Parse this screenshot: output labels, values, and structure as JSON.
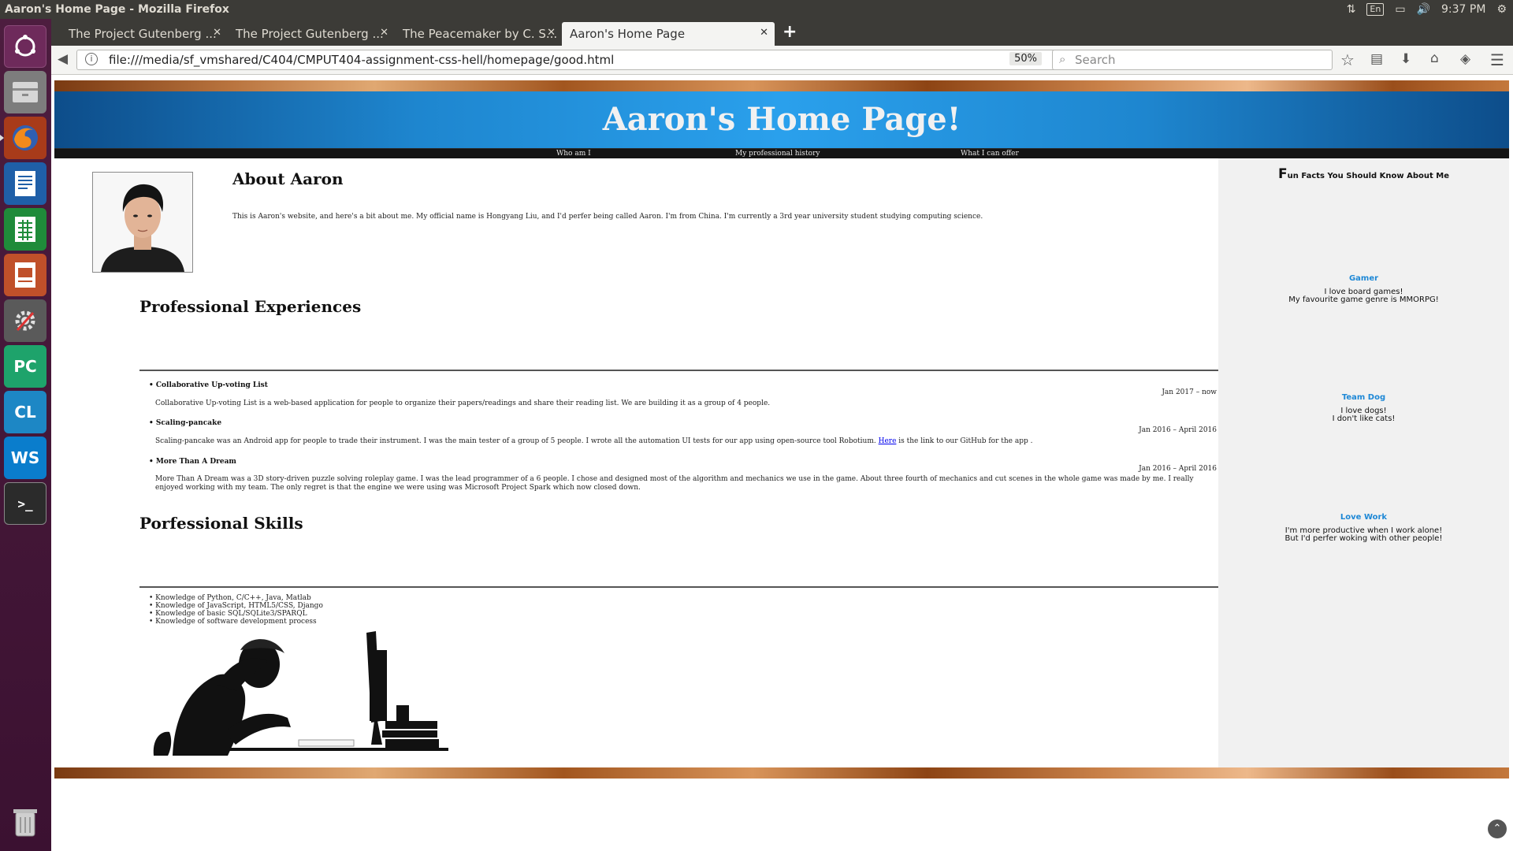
{
  "window": {
    "title": "Aaron's Home Page - Mozilla Firefox",
    "indicators": {
      "keyboard": "En",
      "clock": "9:37 PM"
    }
  },
  "launcher": {
    "items": [
      {
        "name": "ubuntu-dash-icon",
        "label": "",
        "color": "#6e2a5b"
      },
      {
        "name": "files-icon",
        "label": "",
        "color": "#6b6b6b"
      },
      {
        "name": "firefox-icon",
        "label": "",
        "color": "#e66000"
      },
      {
        "name": "writer-icon",
        "label": "",
        "color": "#1f5fa8"
      },
      {
        "name": "calc-icon",
        "label": "",
        "color": "#1f8b3a"
      },
      {
        "name": "impress-icon",
        "label": "",
        "color": "#c0502a"
      },
      {
        "name": "settings-icon",
        "label": "",
        "color": "#5a5a5a"
      },
      {
        "name": "pycharm-icon",
        "label": "PC",
        "color": "#1ea36b"
      },
      {
        "name": "clion-icon",
        "label": "CL",
        "color": "#1d87c5"
      },
      {
        "name": "webstorm-icon",
        "label": "WS",
        "color": "#0a7dcc"
      },
      {
        "name": "terminal-icon",
        "label": ">_",
        "color": "#2b2b2b"
      }
    ],
    "trash": "trash-icon"
  },
  "browser": {
    "tabs": [
      {
        "label": "The Project Gutenberg ...",
        "active": false
      },
      {
        "label": "The Project Gutenberg ...",
        "active": false
      },
      {
        "label": "The Peacemaker by C. S...",
        "active": false
      },
      {
        "label": "Aaron's Home Page",
        "active": true
      }
    ],
    "url": "file:///media/sf_vmshared/C404/CMPUT404-assignment-css-hell/homepage/good.html",
    "zoom": "50%",
    "search_placeholder": "Search"
  },
  "page": {
    "header_title": "Aaron's Home Page!",
    "nav": [
      "Who am I",
      "My professional history",
      "What I can offer"
    ],
    "about": {
      "title": "About Aaron",
      "text": "This is Aaron's website, and here's a bit about me. My official name is Hongyang Liu, and I'd perfer being called Aaron. I'm from China. I'm currently a 3rd year university student studying computing science."
    },
    "experiences": {
      "title": "Professional Experiences",
      "items": [
        {
          "title": "Collaborative Up-voting List",
          "date": "Jan 2017 – now",
          "desc": "Collaborative Up-voting List is a web-based application for people to organize their papers/readings and share their reading list. We are building it as a group of 4 people."
        },
        {
          "title": "Scaling-pancake",
          "date": "Jan 2016 – April 2016",
          "desc_before": "Scaling-pancake was an Android app for people to trade their instrument. I was the main tester of a group of 5 people. I wrote all the automation UI tests for our app using open-source tool Robotium.",
          "link": "Here",
          "desc_after": "is the link to our GitHub for the app ."
        },
        {
          "title": "More Than A Dream",
          "date": "Jan 2016 – April 2016",
          "desc": "More Than A Dream was a 3D story-driven puzzle solving roleplay game. I was the lead programmer of a 6 people. I chose and designed most of the algorithm and mechanics we use in the game. About three fourth of mechanics and cut scenes in the whole game was made by me. I really enjoyed working with my team. The only regret is that the engine we were using was Microsoft Project Spark which now closed down."
        }
      ]
    },
    "skills": {
      "title": "Porfessional Skills",
      "items": [
        "Knowledge of Python, C/C++, Java, Matlab",
        "Knowledge of JavaScript, HTML5/CSS, Django",
        "Knowledge of basic SQL/SQLite3/SPARQL",
        "Knowledge of software development process"
      ]
    },
    "sidebar": {
      "title_initial": "F",
      "title_rest": "un Facts You Should Know About Me",
      "facts": [
        {
          "title": "Gamer",
          "lines": [
            "I love board games!",
            "My favourite game genre is MMORPG!"
          ]
        },
        {
          "title": "Team Dog",
          "lines": [
            "I love dogs!",
            "I don't like cats!"
          ]
        },
        {
          "title": "Love Work",
          "lines": [
            "I'm more productive when I work alone!",
            "But I'd perfer woking with other people!"
          ]
        }
      ]
    },
    "colors": {
      "header_blue": "#2aa0ec",
      "fact_blue": "#1e88d6",
      "sidebar_bg": "#f1f1f1",
      "nav_bg": "#141414"
    }
  }
}
